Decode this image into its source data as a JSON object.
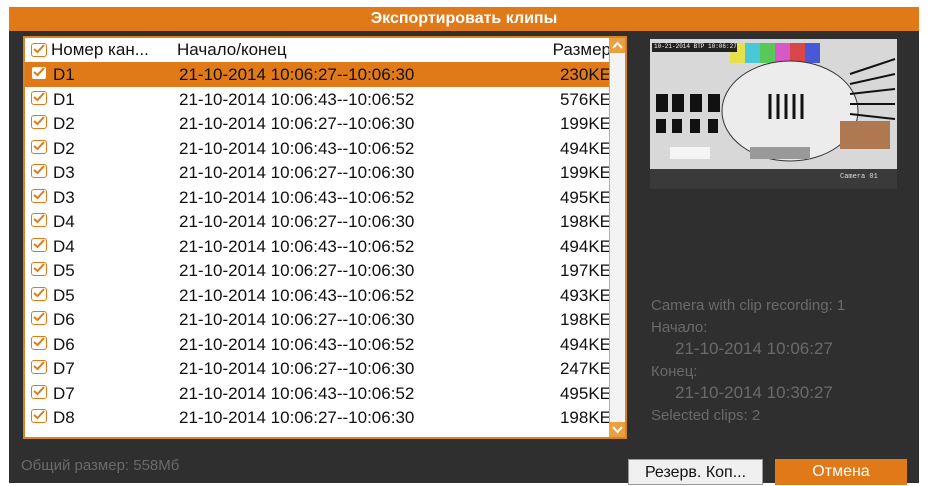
{
  "dialog": {
    "title": "Экспортировать клипы"
  },
  "table": {
    "headers": {
      "channel": "Номер кан...",
      "time": "Начало/конец",
      "size": "Размер"
    },
    "rows": [
      {
        "channel": "D1",
        "time": "21-10-2014 10:06:27--10:06:30",
        "size": "230KE",
        "checked": true,
        "selected": true
      },
      {
        "channel": "D1",
        "time": "21-10-2014 10:06:43--10:06:52",
        "size": "576KE",
        "checked": true,
        "selected": false
      },
      {
        "channel": "D2",
        "time": "21-10-2014 10:06:27--10:06:30",
        "size": "199KE",
        "checked": true,
        "selected": false
      },
      {
        "channel": "D2",
        "time": "21-10-2014 10:06:43--10:06:52",
        "size": "494KE",
        "checked": true,
        "selected": false
      },
      {
        "channel": "D3",
        "time": "21-10-2014 10:06:27--10:06:30",
        "size": "199KE",
        "checked": true,
        "selected": false
      },
      {
        "channel": "D3",
        "time": "21-10-2014 10:06:43--10:06:52",
        "size": "495KE",
        "checked": true,
        "selected": false
      },
      {
        "channel": "D4",
        "time": "21-10-2014 10:06:27--10:06:30",
        "size": "198KE",
        "checked": true,
        "selected": false
      },
      {
        "channel": "D4",
        "time": "21-10-2014 10:06:43--10:06:52",
        "size": "494KE",
        "checked": true,
        "selected": false
      },
      {
        "channel": "D5",
        "time": "21-10-2014 10:06:27--10:06:30",
        "size": "197KE",
        "checked": true,
        "selected": false
      },
      {
        "channel": "D5",
        "time": "21-10-2014 10:06:43--10:06:52",
        "size": "493KE",
        "checked": true,
        "selected": false
      },
      {
        "channel": "D6",
        "time": "21-10-2014 10:06:27--10:06:30",
        "size": "198KE",
        "checked": true,
        "selected": false
      },
      {
        "channel": "D6",
        "time": "21-10-2014 10:06:43--10:06:52",
        "size": "494KE",
        "checked": true,
        "selected": false
      },
      {
        "channel": "D7",
        "time": "21-10-2014 10:06:27--10:06:30",
        "size": "247KE",
        "checked": true,
        "selected": false
      },
      {
        "channel": "D7",
        "time": "21-10-2014 10:06:43--10:06:52",
        "size": "495KE",
        "checked": true,
        "selected": false
      },
      {
        "channel": "D8",
        "time": "21-10-2014 10:06:27--10:06:30",
        "size": "198KE",
        "checked": true,
        "selected": false
      }
    ]
  },
  "preview": {
    "overlay_time": "10-21-2014 ВТР 10:06:27",
    "camera_label": "Camera 01"
  },
  "info": {
    "camera_count": "Camera with clip recording: 1",
    "start_label": "Начало:",
    "start_value": "21-10-2014 10:06:27",
    "end_label": "Конец:",
    "end_value": "21-10-2014 10:30:27",
    "selected_clips": "Selected clips: 2"
  },
  "footer": {
    "total_size": "Общий размер: 558Мб",
    "backup_label": "Резерв. Коп...",
    "cancel_label": "Отмена"
  },
  "colors": {
    "accent": "#e07a18",
    "background": "#2f2f2f",
    "muted_text": "#6a6a6a"
  }
}
